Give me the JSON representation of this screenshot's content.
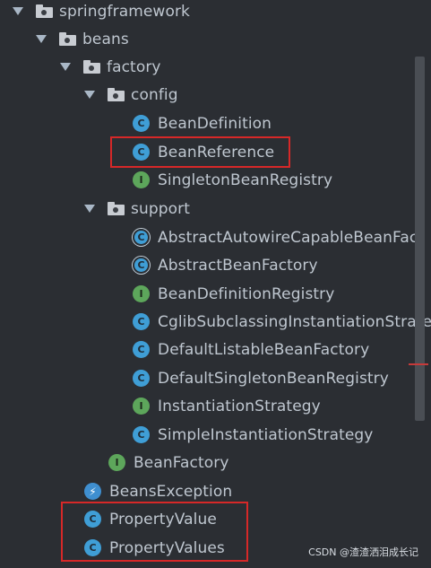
{
  "tree": {
    "springframework": "springframework",
    "beans": "beans",
    "factory": "factory",
    "config": "config",
    "config_items": [
      "BeanDefinition",
      "BeanReference",
      "SingletonBeanRegistry"
    ],
    "support": "support",
    "support_items": [
      "AbstractAutowireCapableBeanFact",
      "AbstractBeanFactory",
      "BeanDefinitionRegistry",
      "CglibSubclassingInstantiationStrate",
      "DefaultListableBeanFactory",
      "DefaultSingletonBeanRegistry",
      "InstantiationStrategy",
      "SimpleInstantiationStrategy"
    ],
    "bean_factory": "BeanFactory",
    "beans_exception": "BeansException",
    "property_value": "PropertyValue",
    "property_values": "PropertyValues"
  },
  "icon_letters": {
    "class": "C",
    "interface": "I"
  },
  "colors": {
    "background": "#2b2e33",
    "class_icon": "#3f9ed6",
    "interface_icon": "#5da65b",
    "highlight_box": "#d62828"
  },
  "watermark": "CSDN @渣渣洒泪成长记"
}
